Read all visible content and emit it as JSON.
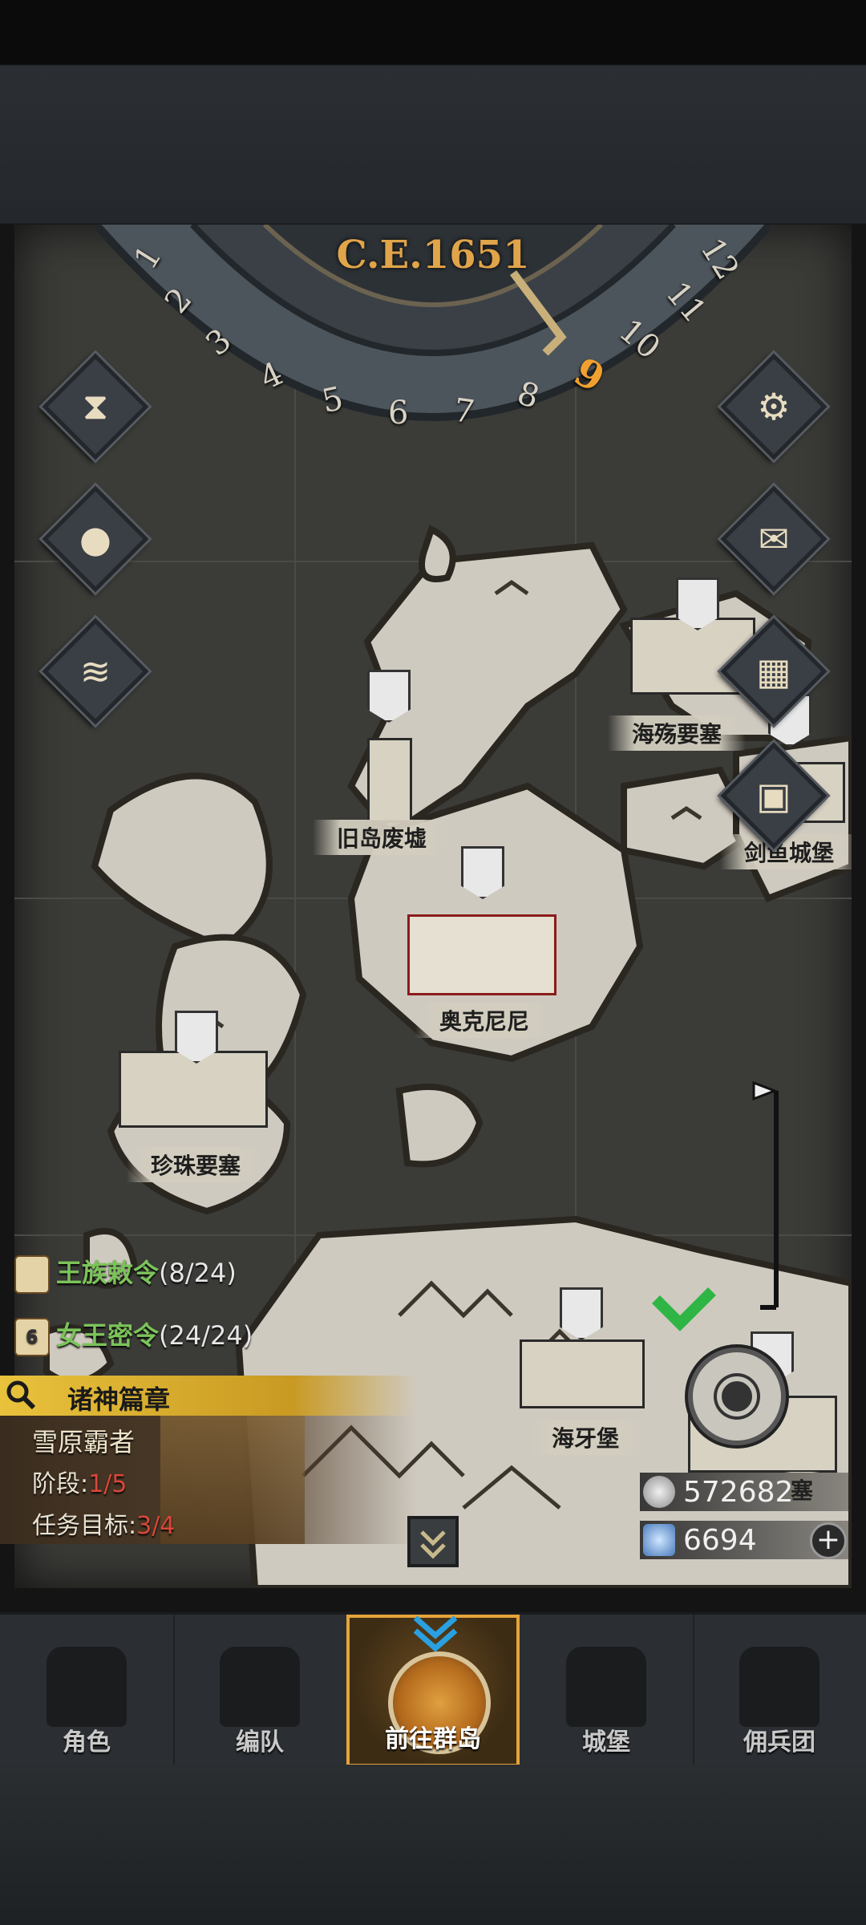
{
  "calendar": {
    "year": "C.E.1651",
    "months": [
      "1",
      "2",
      "3",
      "4",
      "5",
      "6",
      "7",
      "8",
      "9",
      "10",
      "11",
      "12"
    ],
    "current_month": "9"
  },
  "left_buttons": [
    {
      "icon": "hourglass-icon"
    },
    {
      "icon": "money-bag-icon"
    },
    {
      "icon": "scroll-icon"
    }
  ],
  "right_buttons": [
    {
      "icon": "gear-icon"
    },
    {
      "icon": "mail-icon"
    },
    {
      "icon": "grid-map-icon"
    },
    {
      "icon": "supply-crates-icon"
    }
  ],
  "locations": {
    "haishang": "海殇要塞",
    "jiudao": "旧岛废墟",
    "jianyu": "剑鱼城堡",
    "aokenini": "奥克尼尼",
    "zhenzhu": "珍珠要塞",
    "haiya": "海牙堡",
    "partial": "塞"
  },
  "quests": [
    {
      "title": "王族敕令",
      "count": "(8/24)"
    },
    {
      "title": "女王密令",
      "count": "(24/24)",
      "badge": "6"
    }
  ],
  "chapter": {
    "title": "诸神篇章",
    "name": "雪原霸者",
    "stage_label": "阶段:",
    "stage_value": "1/5",
    "goal_label": "任务目标:",
    "goal_value": "3/4"
  },
  "resources": {
    "silver": "572682",
    "crystal": "6694"
  },
  "nav": [
    {
      "label": "角色"
    },
    {
      "label": "编队"
    },
    {
      "label": "前往群岛"
    },
    {
      "label": "城堡"
    },
    {
      "label": "佣兵团"
    }
  ],
  "colors": {
    "accent": "#e6a23a",
    "quest_green": "#7cc35a",
    "progress_red": "#d8473b",
    "month_active": "#f0a030"
  }
}
